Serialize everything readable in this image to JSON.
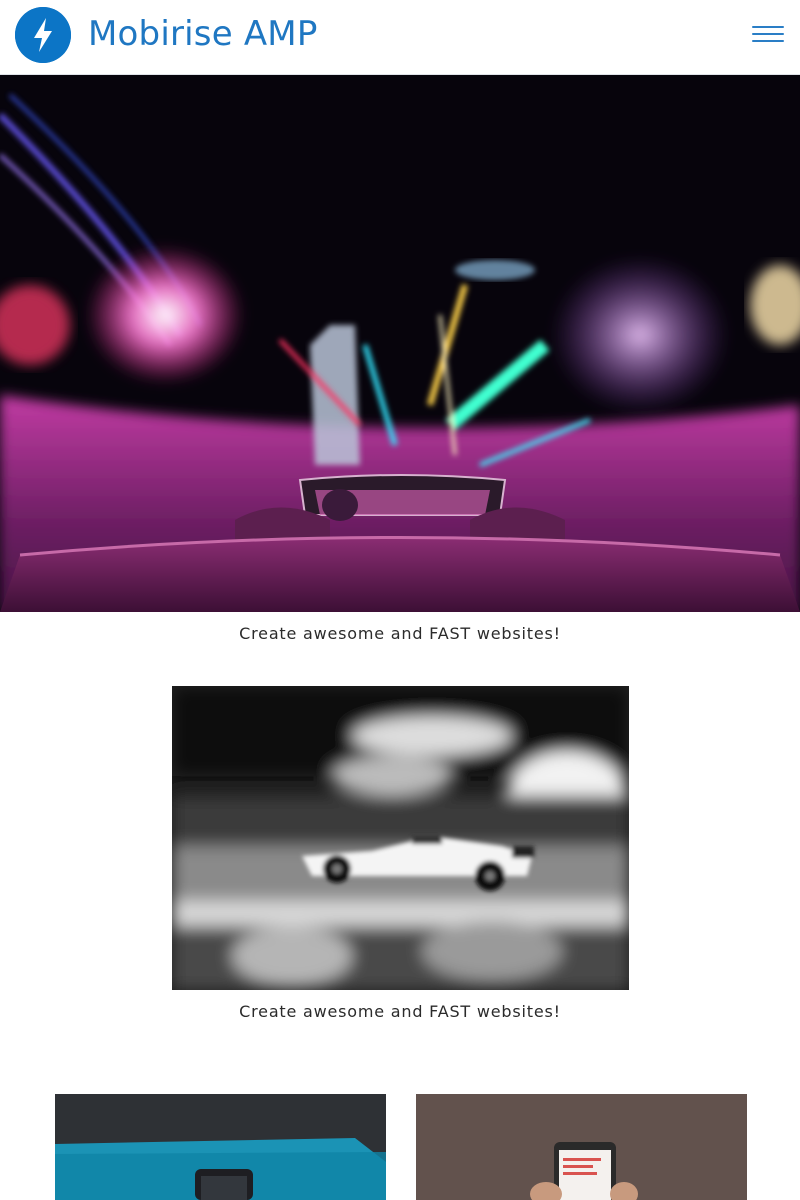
{
  "navbar": {
    "brand_name": "Mobirise AMP",
    "logo_icon": "lightning-bolt-icon",
    "menu_icon": "hamburger-menu-icon",
    "brand_color": "#1f77c2"
  },
  "hero": {
    "image_subject": "night city convertible car light trails",
    "caption": "Create awesome and FAST websites!"
  },
  "gallery": {
    "image_subject": "formula one race car motion blur",
    "caption": "Create awesome and FAST websites!"
  },
  "cards": [
    {
      "image_subject": "phone in hand on teal background"
    },
    {
      "image_subject": "hand holding phone with web page"
    }
  ]
}
